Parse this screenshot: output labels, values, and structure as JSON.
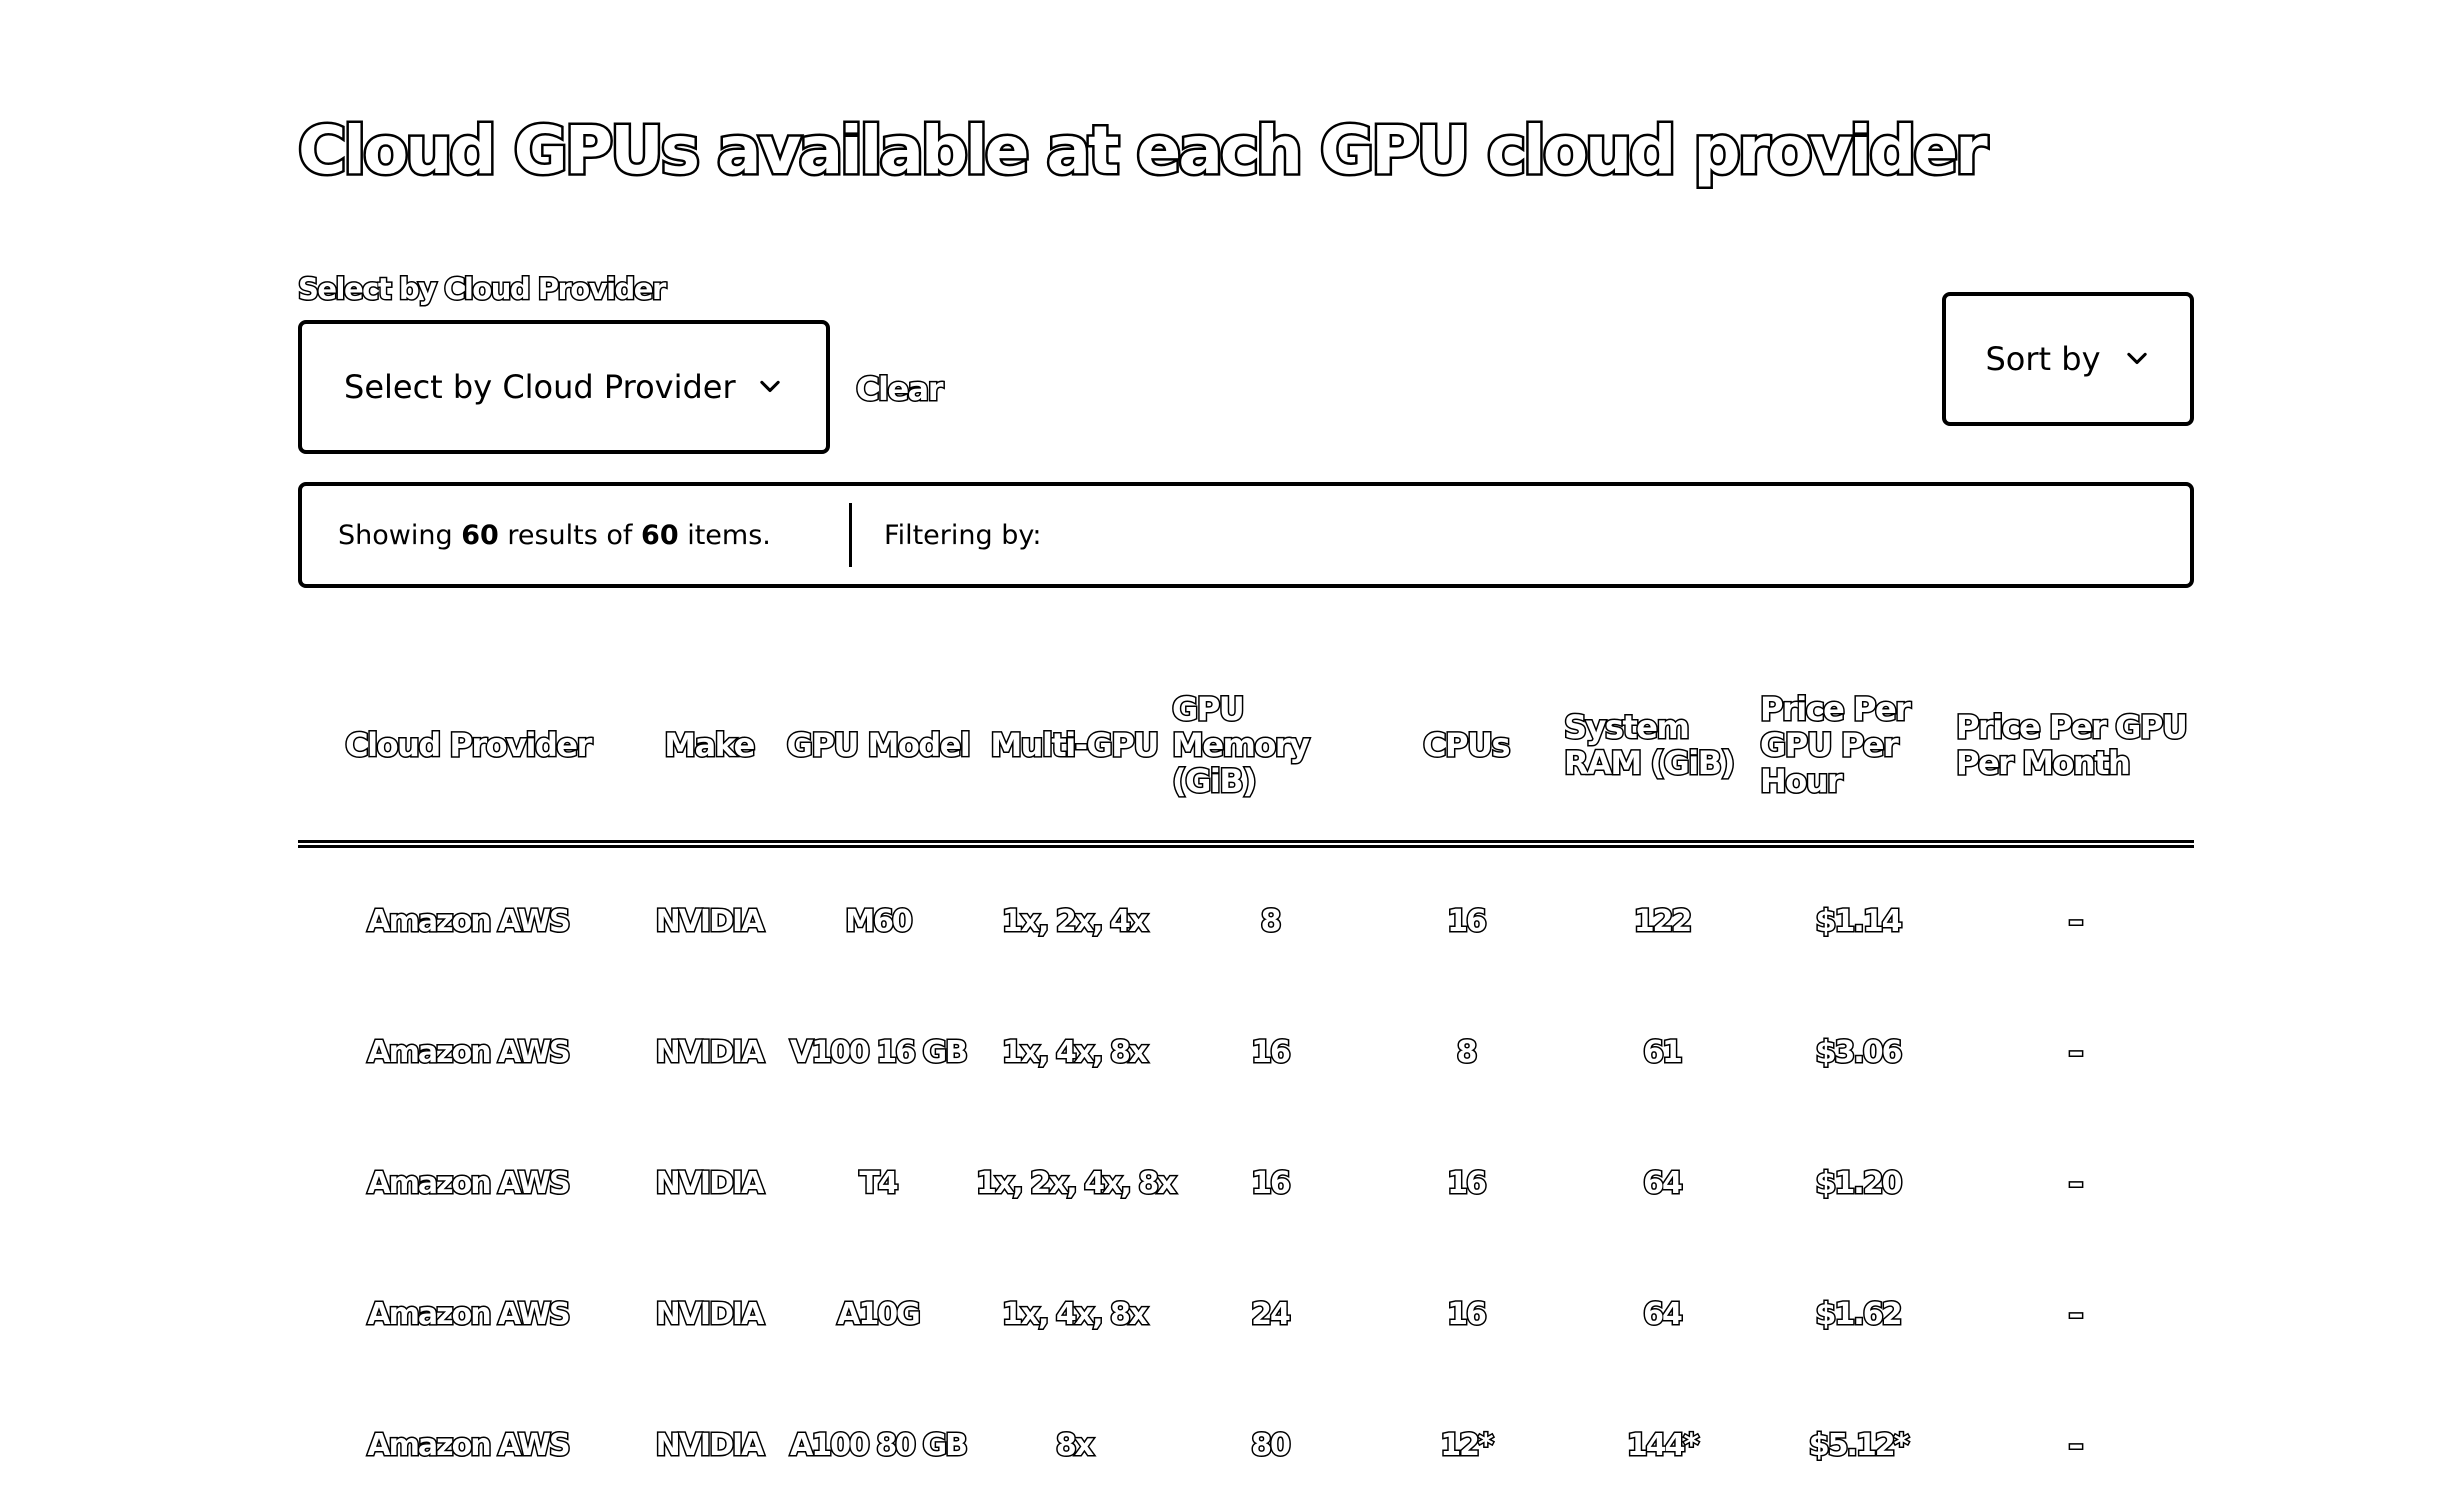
{
  "page": {
    "title": "Cloud GPUs available at each GPU cloud provider"
  },
  "filters": {
    "label": "Select by Cloud Provider",
    "select_value": "Select by Cloud Provider",
    "clear_label": "Clear",
    "sort_label": "Sort by"
  },
  "results": {
    "prefix": "Showing",
    "shown": "60",
    "middle": "results of",
    "total": "60",
    "suffix": "items.",
    "filtering_label": "Filtering by:"
  },
  "table": {
    "headers": [
      "Cloud Provider",
      "Make",
      "GPU Model",
      "Multi-GPU",
      "GPU Memory (GiB)",
      "CPUs",
      "System RAM (GiB)",
      "Price Per GPU Per Hour",
      "Price Per GPU Per Month"
    ],
    "rows": [
      [
        "Amazon AWS",
        "NVIDIA",
        "M60",
        "1x, 2x, 4x",
        "8",
        "16",
        "122",
        "$1.14",
        "–"
      ],
      [
        "Amazon AWS",
        "NVIDIA",
        "V100 16 GB",
        "1x, 4x, 8x",
        "16",
        "8",
        "61",
        "$3.06",
        "–"
      ],
      [
        "Amazon AWS",
        "NVIDIA",
        "T4",
        "1x, 2x, 4x, 8x",
        "16",
        "16",
        "64",
        "$1.20",
        "–"
      ],
      [
        "Amazon AWS",
        "NVIDIA",
        "A10G",
        "1x, 4x, 8x",
        "24",
        "16",
        "64",
        "$1.62",
        "–"
      ],
      [
        "Amazon AWS",
        "NVIDIA",
        "A100 80 GB",
        "8x",
        "80",
        "12*",
        "144*",
        "$5.12*",
        "–"
      ]
    ]
  },
  "icons": {
    "select_chevron": "chevron-down-icon",
    "sort_chevron": "chevron-down-icon"
  }
}
